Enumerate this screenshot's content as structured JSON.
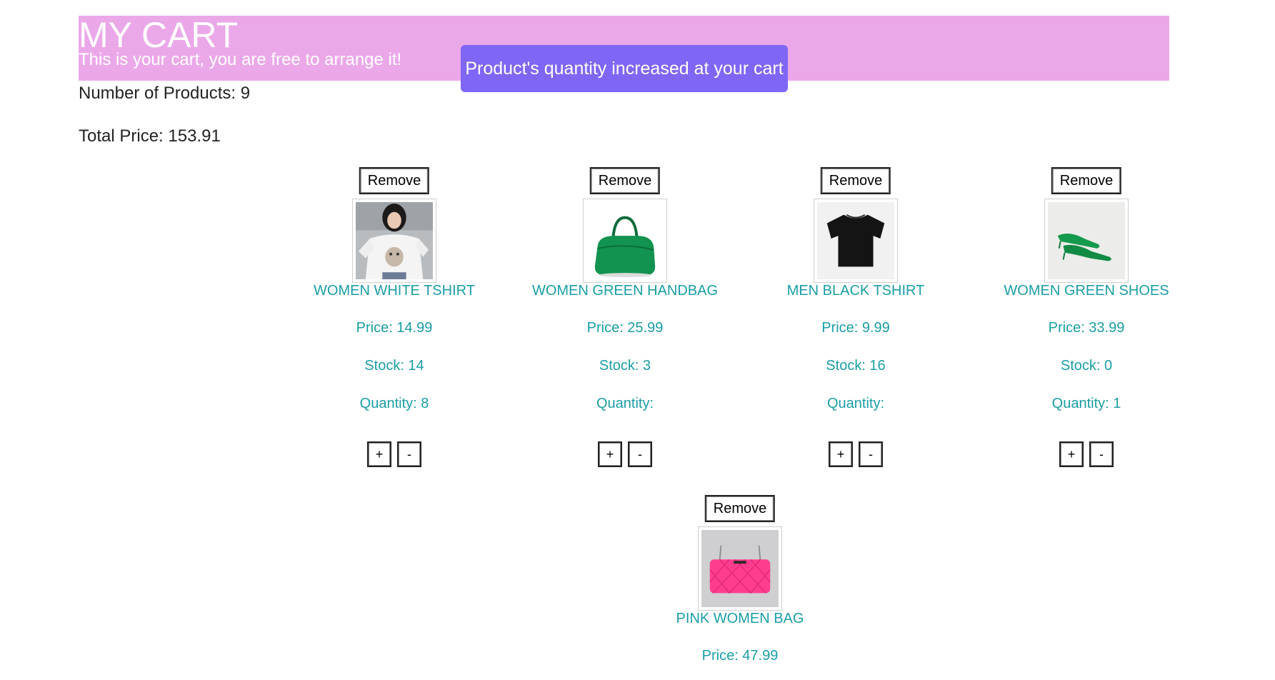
{
  "banner": {
    "title": "MY CART",
    "subtitle": "This is your cart, you are free to arrange it!",
    "background": "#eba8e9"
  },
  "toast": {
    "message": "Product's quantity increased at your cart",
    "color": "#7f66f4"
  },
  "summary": {
    "products_label": "Number of Products: 9",
    "total_label": "Total Price: 153.91"
  },
  "accent_color": "#1a9ea5",
  "products": [
    {
      "remove_label": "Remove",
      "name": "WOMEN WHITE TSHIRT",
      "price": "Price: 14.99",
      "stock": "Stock: 14",
      "quantity": "Quantity: 8",
      "plus_label": "+",
      "minus_label": "-",
      "image": "white-tshirt-photo"
    },
    {
      "remove_label": "Remove",
      "name": "WOMEN GREEN HANDBAG",
      "price": "Price: 25.99",
      "stock": "Stock: 3",
      "quantity": "Quantity:",
      "plus_label": "+",
      "minus_label": "-",
      "image": "green-handbag-photo"
    },
    {
      "remove_label": "Remove",
      "name": "MEN BLACK TSHIRT",
      "price": "Price: 9.99",
      "stock": "Stock: 16",
      "quantity": "Quantity:",
      "plus_label": "+",
      "minus_label": "-",
      "image": "black-tshirt-photo"
    },
    {
      "remove_label": "Remove",
      "name": "WOMEN GREEN SHOES",
      "price": "Price: 33.99",
      "stock": "Stock: 0",
      "quantity": "Quantity: 1",
      "plus_label": "+",
      "minus_label": "-",
      "image": "green-shoes-photo"
    },
    {
      "remove_label": "Remove",
      "name": "PINK WOMEN BAG",
      "price": "Price: 47.99",
      "image": "pink-bag-photo"
    }
  ]
}
